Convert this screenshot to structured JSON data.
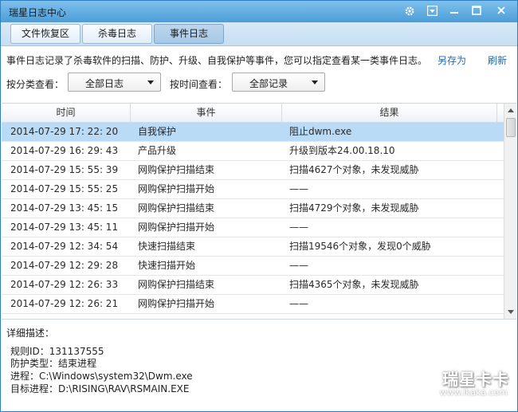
{
  "window": {
    "title": "瑞星日志中心"
  },
  "titlebar_buttons": [
    {
      "name": "settings-icon"
    },
    {
      "name": "dropdown-menu-icon"
    },
    {
      "name": "minimize-icon"
    },
    {
      "name": "maximize-icon"
    },
    {
      "name": "close-icon"
    }
  ],
  "tabs": [
    {
      "label": "文件恢复区",
      "active": false
    },
    {
      "label": "杀毒日志",
      "active": false
    },
    {
      "label": "事件日志",
      "active": true
    }
  ],
  "description": "事件日志记录了杀毒软件的扫描、防护、升级、自我保护等事件，您可以指定查看某一类事件日志。",
  "actions": {
    "save_as": "另存为",
    "refresh": "刷新"
  },
  "filters": {
    "category_label": "按分类查看：",
    "category_value": "全部日志",
    "time_label": "按时间查看：",
    "time_value": "全部记录"
  },
  "table": {
    "columns": [
      "时间",
      "事件",
      "结果"
    ],
    "rows": [
      {
        "time": "2014-07-29 17: 22: 20",
        "event": "自我保护",
        "result": "阻止dwm.exe",
        "selected": true
      },
      {
        "time": "2014-07-29 16: 29: 43",
        "event": "产品升级",
        "result": "升级到版本24.00.18.10",
        "selected": false
      },
      {
        "time": "2014-07-29 15: 55: 39",
        "event": "网购保护扫描结束",
        "result": "扫描4627个对象，未发现威胁",
        "selected": false
      },
      {
        "time": "2014-07-29 15: 55: 25",
        "event": "网购保护扫描开始",
        "result": "——",
        "selected": false
      },
      {
        "time": "2014-07-29 13: 45: 15",
        "event": "网购保护扫描结束",
        "result": "扫描4729个对象，未发现威胁",
        "selected": false
      },
      {
        "time": "2014-07-29 13: 45: 11",
        "event": "网购保护扫描开始",
        "result": "——",
        "selected": false
      },
      {
        "time": "2014-07-29 12: 34: 54",
        "event": "快速扫描结束",
        "result": "扫描19546个对象，发现0个威胁",
        "selected": false
      },
      {
        "time": "2014-07-29 12: 29: 28",
        "event": "快速扫描开始",
        "result": "——",
        "selected": false
      },
      {
        "time": "2014-07-29 12: 26: 33",
        "event": "网购保护扫描结束",
        "result": "扫描4365个对象，未发现威胁",
        "selected": false
      },
      {
        "time": "2014-07-29 12: 26: 21",
        "event": "网购保护扫描开始",
        "result": "——",
        "selected": false
      }
    ]
  },
  "detail": {
    "title": "详细描述：",
    "lines": [
      "规则ID：131137555",
      "防护类型：结束进程",
      "进程：C:\\Windows\\system32\\Dwm.exe",
      "目标进程：D:\\RISING\\RAV\\RSMAIN.EXE"
    ]
  },
  "watermark": {
    "brand": "瑞星卡卡",
    "url": "www.ikaka.com"
  },
  "colors": {
    "titlebar": "#4b9ed8",
    "selected_row": "#b9dbf5",
    "link": "#2468b3"
  }
}
